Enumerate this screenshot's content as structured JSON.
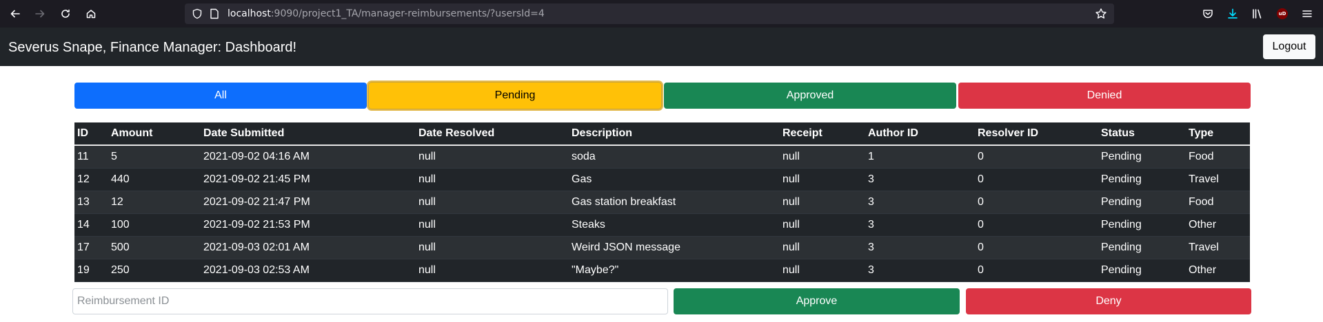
{
  "browser": {
    "url_host": "localhost",
    "url_rest": ":9090/project1_TA/manager-reimbursements/?usersId=4",
    "icons": [
      "back-icon",
      "forward-icon",
      "reload-icon",
      "home-icon",
      "shield-icon",
      "page-icon",
      "star-icon",
      "pocket-icon",
      "download-icon",
      "library-icon",
      "ublock-icon",
      "menu-icon"
    ],
    "ublock_badge": "uD"
  },
  "navbar": {
    "title": "Severus Snape, Finance Manager: Dashboard!",
    "logout_label": "Logout"
  },
  "filters": {
    "all": "All",
    "pending": "Pending",
    "approved": "Approved",
    "denied": "Denied",
    "selected": "Pending"
  },
  "table": {
    "headers": [
      "ID",
      "Amount",
      "Date Submitted",
      "Date Resolved",
      "Description",
      "Receipt",
      "Author ID",
      "Resolver ID",
      "Status",
      "Type"
    ],
    "rows": [
      [
        "11",
        "5",
        "2021-09-02 04:16 AM",
        "null",
        "soda",
        "null",
        "1",
        "0",
        "Pending",
        "Food"
      ],
      [
        "12",
        "440",
        "2021-09-02 21:45 PM",
        "null",
        "Gas",
        "null",
        "3",
        "0",
        "Pending",
        "Travel"
      ],
      [
        "13",
        "12",
        "2021-09-02 21:47 PM",
        "null",
        "Gas station breakfast",
        "null",
        "3",
        "0",
        "Pending",
        "Food"
      ],
      [
        "14",
        "100",
        "2021-09-02 21:53 PM",
        "null",
        "Steaks",
        "null",
        "3",
        "0",
        "Pending",
        "Other"
      ],
      [
        "17",
        "500",
        "2021-09-03 02:01 AM",
        "null",
        "Weird JSON message",
        "null",
        "3",
        "0",
        "Pending",
        "Travel"
      ],
      [
        "19",
        "250",
        "2021-09-03 02:53 AM",
        "null",
        "\"Maybe?\"",
        "null",
        "3",
        "0",
        "Pending",
        "Other"
      ]
    ]
  },
  "form": {
    "input_placeholder": "Reimbursement ID",
    "input_value": "",
    "approve_label": "Approve",
    "deny_label": "Deny"
  },
  "colors": {
    "primary": "#0d6efd",
    "warning": "#ffc107",
    "success": "#198754",
    "danger": "#dc3545",
    "dark": "#212529"
  }
}
